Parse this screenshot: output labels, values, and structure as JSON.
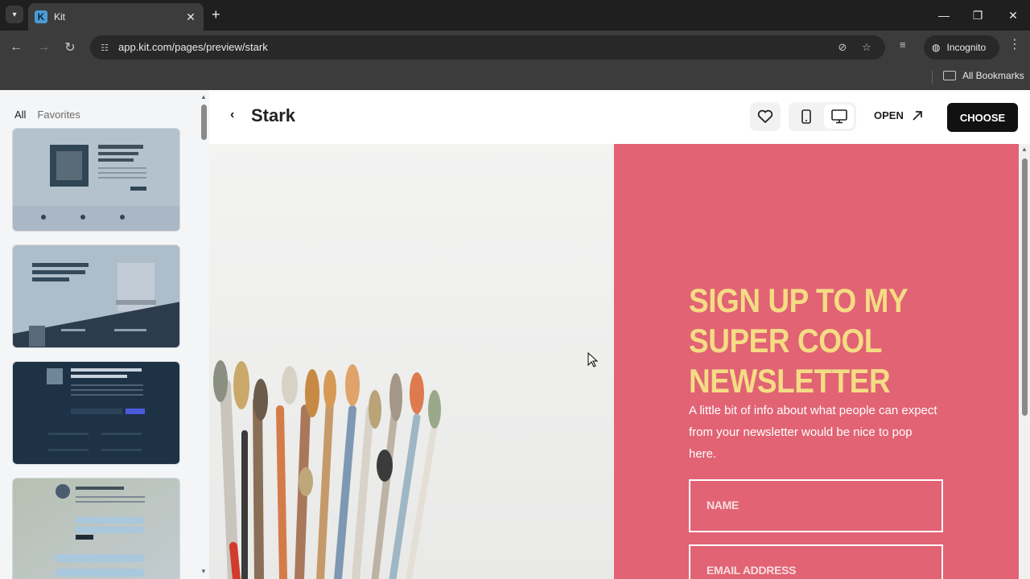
{
  "browser": {
    "tab_title": "Kit",
    "tab_favicon": "K",
    "url": "app.kit.com/pages/preview/stark",
    "incognito_label": "Incognito",
    "bookmarks_label": "All Bookmarks"
  },
  "sidebar": {
    "tabs": [
      {
        "label": "All",
        "active": true
      },
      {
        "label": "Favorites",
        "active": false
      }
    ],
    "thumbnails": [
      {
        "heading": "Download the first chapter of When We Become Real",
        "colors": [
          "#9fb0bd",
          "#2f4654"
        ]
      },
      {
        "heading": "How to Get 100,000 Email Subscribers in Six Months",
        "colors": [
          "#aab9c7",
          "#2c3c4c"
        ]
      },
      {
        "heading": "Hey Instagram friend, it's me, Alexander Grady!",
        "colors": [
          "#1e3246",
          "#4b5bdc"
        ]
      },
      {
        "heading": "Say hello to Aiden!",
        "colors": [
          "#b9c2b4",
          "#a9c7dd"
        ]
      }
    ]
  },
  "preview": {
    "back_icon": "chevron-left-icon",
    "title": "Stark",
    "open_label": "OPEN",
    "choose_label": "CHOOSE",
    "device_selected": "desktop"
  },
  "landing": {
    "headline_lines": [
      "SIGN UP TO MY",
      "SUPER COOL",
      "NEWSLETTER"
    ],
    "subtext": "A little bit of info about what people can expect from your newsletter would be nice to pop here.",
    "name_placeholder": "NAME",
    "email_placeholder": "EMAIL ADDRESS",
    "colors": {
      "panel": "#e16374",
      "headline": "#f5dc84"
    }
  }
}
